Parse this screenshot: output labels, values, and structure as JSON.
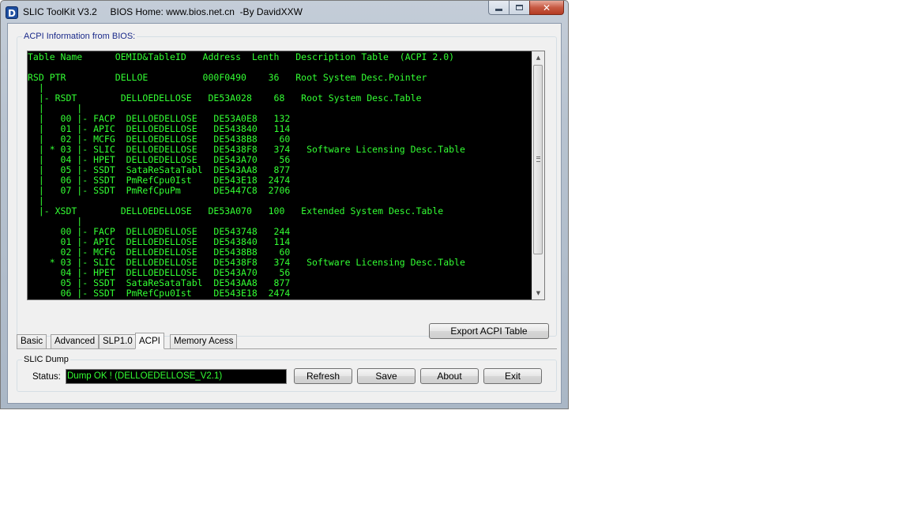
{
  "window": {
    "title": "SLIC ToolKit V3.2     BIOS Home: www.bios.net.cn  -By DavidXXW",
    "app_icon_glyph": "D",
    "controls": {
      "minimize": "minimize",
      "maximize": "maximize",
      "close_glyph": "✕"
    }
  },
  "acpi_group": {
    "legend": "ACPI Information from BIOS:",
    "console_lines": [
      "Table Name      OEMID&TableID   Address  Lenth   Description Table  (ACPI 2.0)",
      "",
      "RSD PTR         DELLOE          000F0490    36   Root System Desc.Pointer",
      "  |",
      "  |- RSDT        DELLOEDELLOSE   DE53A028    68   Root System Desc.Table",
      "  |      |",
      "  |   00 |- FACP  DELLOEDELLOSE   DE53A0E8   132",
      "  |   01 |- APIC  DELLOEDELLOSE   DE543840   114",
      "  |   02 |- MCFG  DELLOEDELLOSE   DE5438B8    60",
      "  | * 03 |- SLIC  DELLOEDELLOSE   DE5438F8   374   Software Licensing Desc.Table",
      "  |   04 |- HPET  DELLOEDELLOSE   DE543A70    56",
      "  |   05 |- SSDT  SataReSataTabl  DE543AA8   877",
      "  |   06 |- SSDT  PmRefCpu0Ist    DE543E18  2474",
      "  |   07 |- SSDT  PmRefCpuPm      DE5447C8  2706",
      "  |",
      "  |- XSDT        DELLOEDELLOSE   DE53A070   100   Extended System Desc.Table",
      "         |",
      "      00 |- FACP  DELLOEDELLOSE   DE543748   244",
      "      01 |- APIC  DELLOEDELLOSE   DE543840   114",
      "      02 |- MCFG  DELLOEDELLOSE   DE5438B8    60",
      "    * 03 |- SLIC  DELLOEDELLOSE   DE5438F8   374   Software Licensing Desc.Table",
      "      04 |- HPET  DELLOEDELLOSE   DE543A70    56",
      "      05 |- SSDT  SataReSataTabl  DE543AA8   877",
      "      06 |- SSDT  PmRefCpu0Ist    DE543E18  2474"
    ],
    "export_button": "Export ACPI Table"
  },
  "tabs": [
    {
      "label": "Basic",
      "active": false
    },
    {
      "label": "Advanced",
      "active": false
    },
    {
      "label": "SLP1.0",
      "active": false
    },
    {
      "label": "ACPI",
      "active": true
    },
    {
      "label": "Memory Acess",
      "active": false
    }
  ],
  "dump_group": {
    "legend": "SLIC Dump",
    "status_label": "Status:",
    "status_value": "Dump OK ! (DELLOEDELLOSE_V2.1)",
    "buttons": {
      "refresh": "Refresh",
      "save": "Save",
      "about": "About",
      "exit": "Exit"
    }
  },
  "colors": {
    "console_bg": "#000000",
    "console_text": "#33ff33",
    "legend_accent": "#1a2a8a",
    "close_button": "#c75a43"
  }
}
